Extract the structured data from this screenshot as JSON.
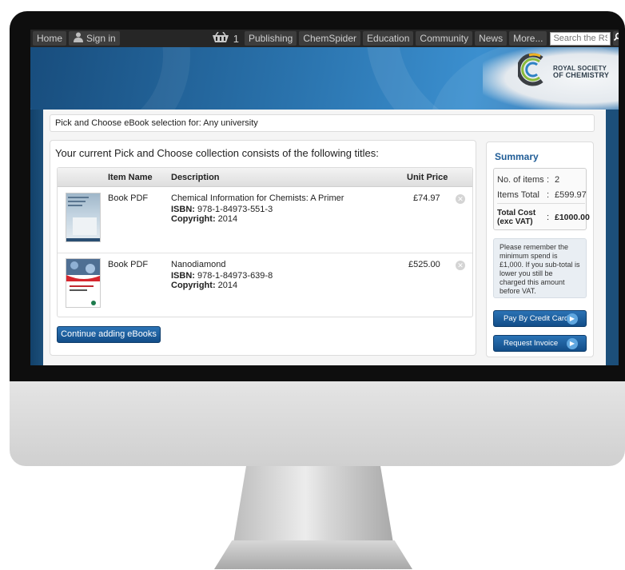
{
  "nav": {
    "home": "Home",
    "sign_in": "Sign in",
    "basket_count": "1",
    "items": [
      "Publishing",
      "ChemSpider",
      "Education",
      "Community",
      "News",
      "More..."
    ],
    "search_placeholder": "Search the RSC"
  },
  "logo": {
    "line1": "ROYAL SOCIETY",
    "line2": "OF CHEMISTRY"
  },
  "pick_bar": "Pick and Choose eBook selection for: Any university",
  "collection": {
    "title": "Your current Pick and Choose collection consists of the following titles:",
    "headers": {
      "item_name": "Item Name",
      "description": "Description",
      "unit_price": "Unit Price"
    },
    "rows": [
      {
        "item_name": "Book PDF",
        "title": "Chemical Information for Chemists: A Primer",
        "isbn_label": "ISBN:",
        "isbn": "978-1-84973-551-3",
        "copyright_label": "Copyright:",
        "copyright": "2014",
        "price": "£74.97"
      },
      {
        "item_name": "Book PDF",
        "title": "Nanodiamond",
        "isbn_label": "ISBN:",
        "isbn": "978-1-84973-639-8",
        "copyright_label": "Copyright:",
        "copyright": "2014",
        "price": "£525.00"
      }
    ],
    "continue_label": "Continue adding eBooks"
  },
  "summary": {
    "title": "Summary",
    "items_label": "No. of items",
    "items_value": "2",
    "total_label": "Items Total",
    "total_value": "£599.97",
    "cost_label": "Total Cost (exc VAT)",
    "cost_value": "£1000.00",
    "note": "Please remember the minimum spend is £1,000. If you sub-total is lower you still be charged this amount before VAT.",
    "pay_label": "Pay By Credit Card",
    "invoice_label": "Request Invoice"
  },
  "colors": {
    "accent": "#1f5c96",
    "button": "#1a5d9c",
    "nav_bg": "#262626"
  }
}
